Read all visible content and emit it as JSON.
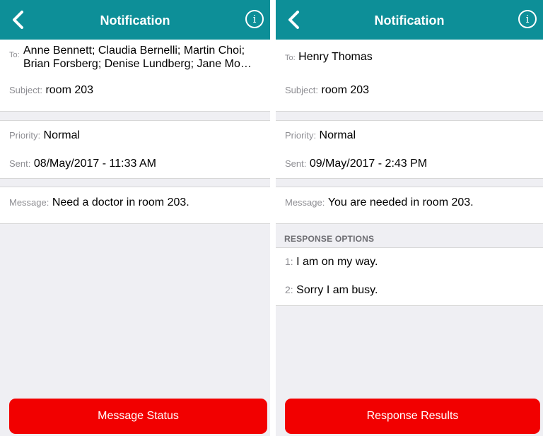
{
  "left": {
    "header": {
      "title": "Notification"
    },
    "to": {
      "label": "To:",
      "line1": "Anne Bennett; Claudia Bernelli; Martin Choi;",
      "line2": "Brian Forsberg; Denise Lundberg; Jane Mo…"
    },
    "subject": {
      "label": "Subject:",
      "value": "room 203"
    },
    "priority": {
      "label": "Priority:",
      "value": "Normal"
    },
    "sent": {
      "label": "Sent:",
      "value": "08/May/2017 - 11:33 AM"
    },
    "message": {
      "label": "Message:",
      "value": "Need a doctor in room 203."
    },
    "button_label": "Message Status"
  },
  "right": {
    "header": {
      "title": "Notification"
    },
    "to": {
      "label": "To:",
      "value": "Henry Thomas"
    },
    "subject": {
      "label": "Subject:",
      "value": "room 203"
    },
    "priority": {
      "label": "Priority:",
      "value": "Normal"
    },
    "sent": {
      "label": "Sent:",
      "value": "09/May/2017 - 2:43 PM"
    },
    "message": {
      "label": "Message:",
      "value": "You are needed in room 203."
    },
    "response_options": {
      "header": "RESPONSE OPTIONS",
      "items": [
        {
          "number": "1:",
          "text": "I am on my way."
        },
        {
          "number": "2:",
          "text": "Sorry I am busy."
        }
      ]
    },
    "button_label": "Response Results"
  },
  "icons": {
    "back": "chevron-left-icon",
    "info": "info-circle-icon",
    "info_glyph": "i"
  },
  "colors": {
    "header": "#0d8f98",
    "button": "#f20000",
    "background": "#efeff3"
  }
}
